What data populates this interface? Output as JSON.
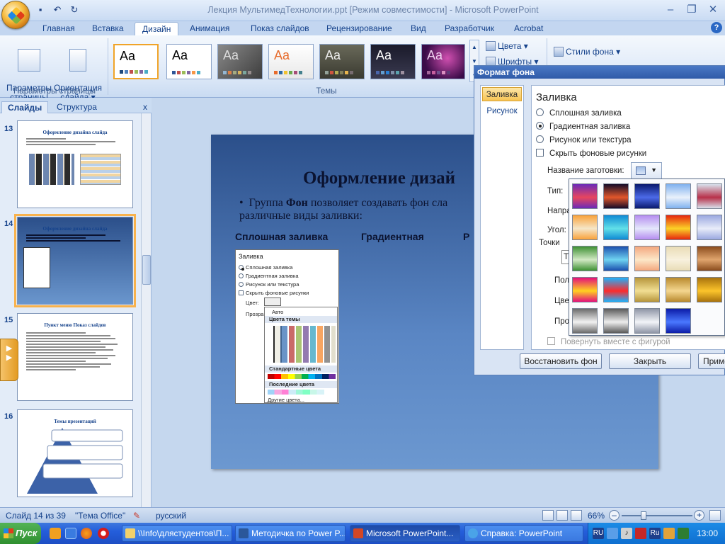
{
  "window": {
    "title": "Лекция МультимедТехнологии.ppt [Режим совместимости] - Microsoft PowerPoint",
    "controls": {
      "minimize": "–",
      "maximize": "❐",
      "close": "✕"
    }
  },
  "quick_access": {
    "save": "▪",
    "undo": "↶",
    "redo": "↻"
  },
  "tabs": [
    "Главная",
    "Вставка",
    "Дизайн",
    "Анимация",
    "Показ слайдов",
    "Рецензирование",
    "Вид",
    "Разработчик",
    "Acrobat"
  ],
  "active_tab": "Дизайн",
  "ribbon": {
    "page_setup_label": "Параметры\nстраницы",
    "orientation_label": "Ориентация\nслайда ▾",
    "page_setup_group": "Параметры страницы",
    "themes_group": "Темы",
    "colors": "Цвета ▾",
    "fonts": "Шрифты ▾",
    "bg_styles": "Стили фона ▾",
    "theme_text": "Aa"
  },
  "left_pane": {
    "tab_slides": "Слайды",
    "tab_outline": "Структура",
    "close": "x",
    "slides": [
      {
        "num": "13",
        "title": "Оформление дизайна слайда"
      },
      {
        "num": "14",
        "title": "Оформление дизайна слайда"
      },
      {
        "num": "15",
        "title": "Пункт меню Показ слайдов"
      },
      {
        "num": "16",
        "title": "Темы презентаций"
      }
    ]
  },
  "slide": {
    "title": "Оформление дизай",
    "bullet_prefix": "Группа ",
    "bullet_bold": "Фон",
    "bullet_rest": " позволяет создавать фон сла различные виды заливки:",
    "col1": "Сплошная заливка",
    "col2": "Градиентная",
    "col3": "Р",
    "mini": {
      "heading": "Заливка",
      "opt1": "Сплошная заливка",
      "opt2": "Градиентная заливка",
      "opt3": "Рисунок или текстура",
      "opt4": "Скрыть фоновые рисунки",
      "color": "Цвет:",
      "transp": "Прозра",
      "auto": "Авто",
      "theme_colors": "Цвета темы",
      "std_colors": "Стандартные цвета",
      "recent": "Последние цвета",
      "more": "Другие цвета..."
    }
  },
  "dialog": {
    "title": "Формат фона",
    "nav": [
      "Заливка",
      "Рисунок"
    ],
    "heading": "Заливка",
    "options": [
      "Сплошная заливка",
      "Градиентная заливка",
      "Рисунок или текстура"
    ],
    "hide_bg": "Скрыть фоновые рисунки",
    "preset_label": "Название заготовки:",
    "fields": [
      "Тип:",
      "Напра",
      "Угол:",
      "Точки",
      "Т",
      "Пол",
      "Цве",
      "Про"
    ],
    "rotate": "Повернуть вместе с фигурой",
    "buttons": [
      "Восстановить фон",
      "Закрыть",
      "Приме"
    ]
  },
  "presets": [
    [
      "#6a2ab8",
      "#e8465e"
    ],
    [
      "#140b28",
      "#e2572a"
    ],
    [
      "#0a1a6e",
      "#4c6ae8"
    ],
    [
      "#7fb1ef",
      "#e9f1fb"
    ],
    [
      "#d9e2ec",
      "#b8314a"
    ],
    [
      "#f9a23a",
      "#f5e6c8"
    ],
    [
      "#0e8ad4",
      "#62e0e8"
    ],
    [
      "#b58cf0",
      "#e4e7fb"
    ],
    [
      "#e6260e",
      "#fbd227"
    ],
    [
      "#9aa8e0",
      "#e8ecf9"
    ],
    [
      "#3d8f33",
      "#d2e9c4"
    ],
    [
      "#1b4fae",
      "#6fd3f1"
    ],
    [
      "#f3a77e",
      "#fce7c8"
    ],
    [
      "#e9dcb6",
      "#f8f1de"
    ],
    [
      "#8a4b1d",
      "#e0a56d"
    ],
    [
      "#e30f7b",
      "#ffd21f"
    ],
    [
      "#1bb3ff",
      "#ff2a2a"
    ],
    [
      "#b6953a",
      "#f1de93"
    ],
    [
      "#b98a2d",
      "#f4d68f"
    ],
    [
      "#a8720d",
      "#fcc42b"
    ],
    [
      "#6b6b6b",
      "#f2f2f2"
    ],
    [
      "#5a5a5a",
      "#ededed"
    ],
    [
      "#8e95a6",
      "#f2f4f8"
    ],
    [
      "#0c1ca8",
      "#4a78ff"
    ]
  ],
  "statusbar": {
    "slide_info": "Слайд 14 из 39",
    "theme": "\"Тема Office\"",
    "language": "русский",
    "zoom": "66%",
    "zoom_value": 66,
    "zoom_minus": "–",
    "zoom_plus": "+"
  },
  "taskbar": {
    "start": "Пуск",
    "tasks": [
      "\\\\Info\\длястудентов\\П...",
      "Методичка по Power P...",
      "Microsoft PowerPoint...",
      "Справка: PowerPoint"
    ],
    "active_task": 2,
    "lang": "RU",
    "lang2": "Ru",
    "clock": "13:00"
  }
}
